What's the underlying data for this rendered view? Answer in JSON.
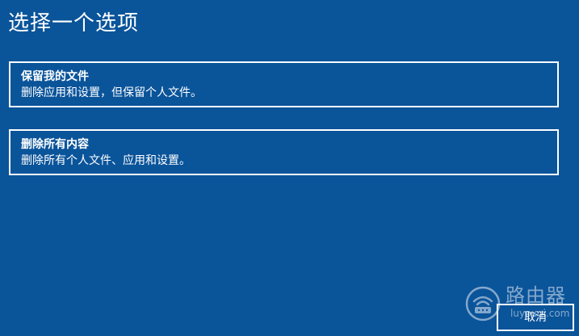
{
  "header": {
    "title": "选择一个选项"
  },
  "options": [
    {
      "title": "保留我的文件",
      "description": "删除应用和设置，但保留个人文件。"
    },
    {
      "title": "删除所有内容",
      "description": "删除所有个人文件、应用和设置。"
    }
  ],
  "footer": {
    "cancel_label": "取消"
  },
  "watermark": {
    "name": "路由器",
    "url": "luyouqi.com",
    "icon": "router-logo-icon"
  },
  "colors": {
    "background": "#0a549a",
    "foreground": "#ffffff"
  }
}
